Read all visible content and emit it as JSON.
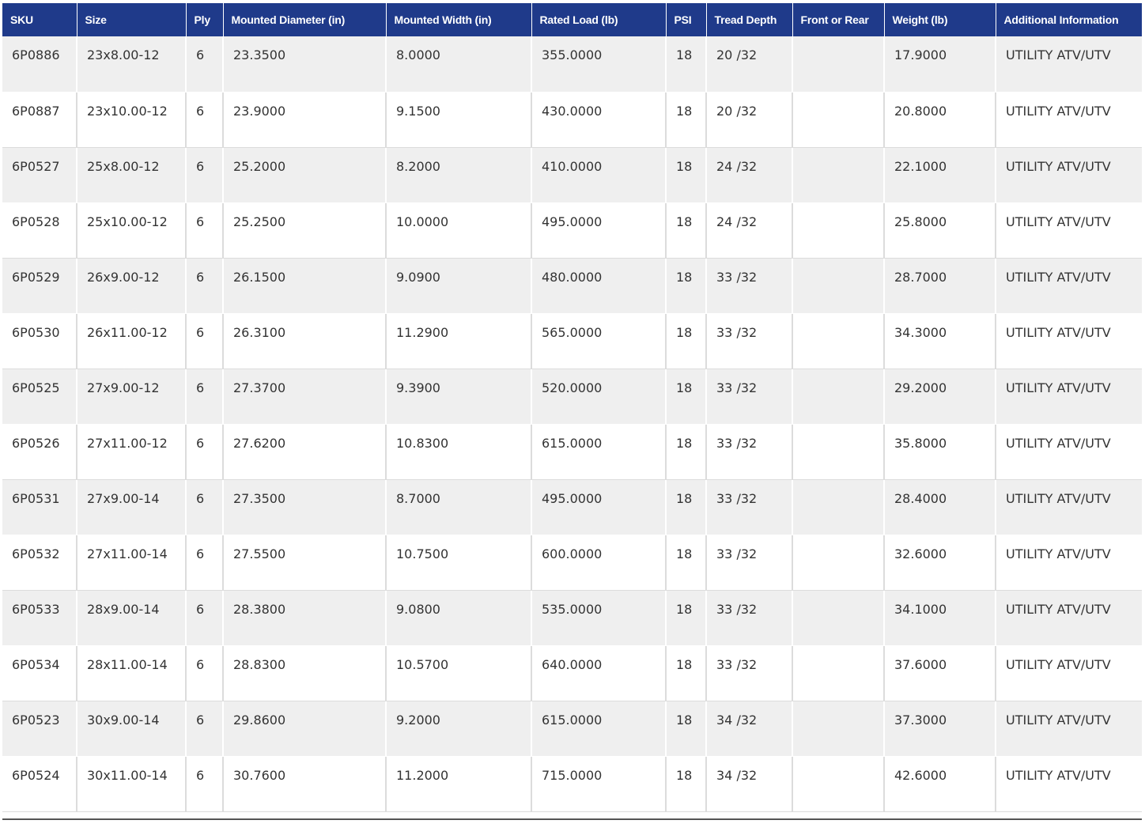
{
  "table": {
    "headers": [
      "SKU",
      "Size",
      "Ply",
      "Mounted Diameter (in)",
      "Mounted Width (in)",
      "Rated Load (lb)",
      "PSI",
      "Tread Depth",
      "Front or Rear",
      "Weight (lb)",
      "Additional Information"
    ],
    "rows": [
      [
        "6P0886",
        "23x8.00-12",
        "6",
        "23.3500",
        "8.0000",
        "355.0000",
        "18",
        "20 /32",
        "",
        "17.9000",
        "UTILITY ATV/UTV"
      ],
      [
        "6P0887",
        "23x10.00-12",
        "6",
        "23.9000",
        "9.1500",
        "430.0000",
        "18",
        "20 /32",
        "",
        "20.8000",
        "UTILITY ATV/UTV"
      ],
      [
        "6P0527",
        "25x8.00-12",
        "6",
        "25.2000",
        "8.2000",
        "410.0000",
        "18",
        "24 /32",
        "",
        "22.1000",
        "UTILITY ATV/UTV"
      ],
      [
        "6P0528",
        "25x10.00-12",
        "6",
        "25.2500",
        "10.0000",
        "495.0000",
        "18",
        "24 /32",
        "",
        "25.8000",
        "UTILITY ATV/UTV"
      ],
      [
        "6P0529",
        "26x9.00-12",
        "6",
        "26.1500",
        "9.0900",
        "480.0000",
        "18",
        "33 /32",
        "",
        "28.7000",
        "UTILITY ATV/UTV"
      ],
      [
        "6P0530",
        "26x11.00-12",
        "6",
        "26.3100",
        "11.2900",
        "565.0000",
        "18",
        "33 /32",
        "",
        "34.3000",
        "UTILITY ATV/UTV"
      ],
      [
        "6P0525",
        "27x9.00-12",
        "6",
        "27.3700",
        "9.3900",
        "520.0000",
        "18",
        "33 /32",
        "",
        "29.2000",
        "UTILITY ATV/UTV"
      ],
      [
        "6P0526",
        "27x11.00-12",
        "6",
        "27.6200",
        "10.8300",
        "615.0000",
        "18",
        "33 /32",
        "",
        "35.8000",
        "UTILITY ATV/UTV"
      ],
      [
        "6P0531",
        "27x9.00-14",
        "6",
        "27.3500",
        "8.7000",
        "495.0000",
        "18",
        "33 /32",
        "",
        "28.4000",
        "UTILITY ATV/UTV"
      ],
      [
        "6P0532",
        "27x11.00-14",
        "6",
        "27.5500",
        "10.7500",
        "600.0000",
        "18",
        "33 /32",
        "",
        "32.6000",
        "UTILITY ATV/UTV"
      ],
      [
        "6P0533",
        "28x9.00-14",
        "6",
        "28.3800",
        "9.0800",
        "535.0000",
        "18",
        "33 /32",
        "",
        "34.1000",
        "UTILITY ATV/UTV"
      ],
      [
        "6P0534",
        "28x11.00-14",
        "6",
        "28.8300",
        "10.5700",
        "640.0000",
        "18",
        "33 /32",
        "",
        "37.6000",
        "UTILITY ATV/UTV"
      ],
      [
        "6P0523",
        "30x9.00-14",
        "6",
        "29.8600",
        "9.2000",
        "615.0000",
        "18",
        "34 /32",
        "",
        "37.3000",
        "UTILITY ATV/UTV"
      ],
      [
        "6P0524",
        "30x11.00-14",
        "6",
        "30.7600",
        "11.2000",
        "715.0000",
        "18",
        "34 /32",
        "",
        "42.6000",
        "UTILITY ATV/UTV"
      ]
    ]
  },
  "colors": {
    "header_bg": "#1f3a8a",
    "header_text": "#ffffff",
    "row_odd_bg": "#efefef",
    "row_even_bg": "#ffffff",
    "cell_text": "#333333"
  }
}
